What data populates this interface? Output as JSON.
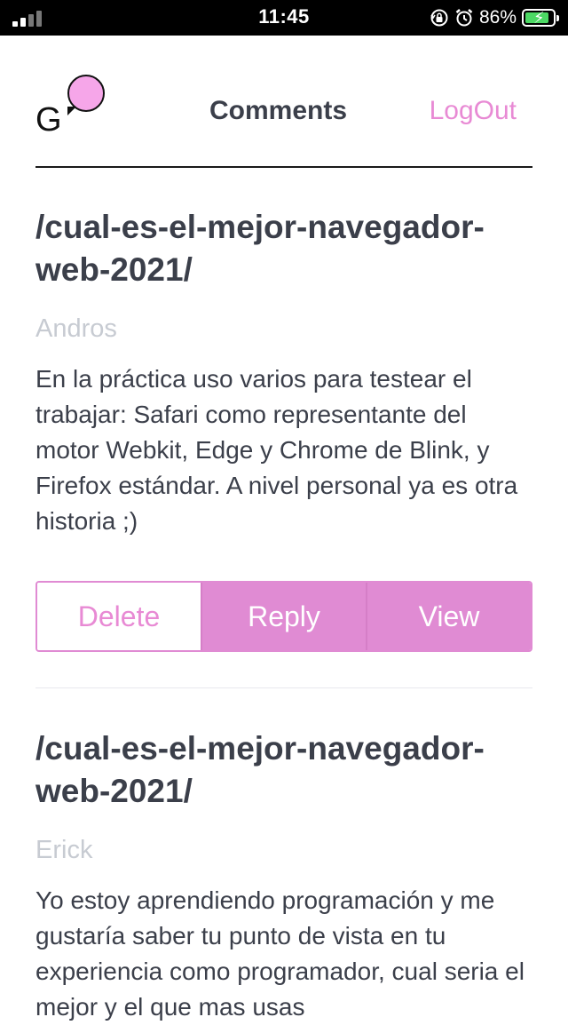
{
  "status_bar": {
    "time": "11:45",
    "battery_percent": "86%",
    "battery_level": 0.86,
    "icons": [
      "signal-icon",
      "orientation-lock-icon",
      "alarm-icon",
      "battery-charging-icon"
    ]
  },
  "header": {
    "logo_letter": "G",
    "title": "Comments",
    "logout_label": "LogOut"
  },
  "colors": {
    "accent": "#e08bd3",
    "accent_text": "#e88ad4",
    "logo_bubble": "#f6a6e9",
    "muted": "#c7cbd2",
    "text": "#3b3f4a"
  },
  "comments": [
    {
      "slug_line1": "/cual-es-el-mejor-navegador-",
      "slug_line2": "web-2021/",
      "author": "Andros",
      "body": "En la práctica uso varios para testear el trabajar: Safari como representante del motor Webkit, Edge y Chrome de Blink, y Firefox estándar. A nivel personal ya es otra historia ;)",
      "actions": {
        "delete": "Delete",
        "reply": "Reply",
        "view": "View"
      }
    },
    {
      "slug_line1": "/cual-es-el-mejor-navegador-",
      "slug_line2": "web-2021/",
      "author": "Erick",
      "body": "Yo estoy aprendiendo programación y me gustaría saber tu punto de vista en tu experiencia como programador, cual seria el mejor y el que mas usas"
    }
  ]
}
